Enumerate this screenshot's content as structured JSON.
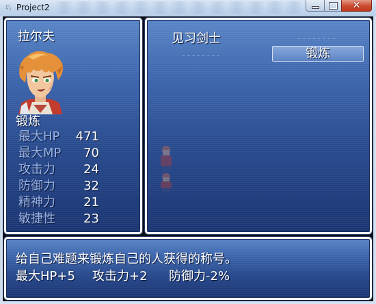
{
  "window": {
    "title": "Project2"
  },
  "status": {
    "actor_name": "拉尔夫",
    "current_title": "锻炼",
    "stats": [
      {
        "label": "最大HP",
        "value": "471"
      },
      {
        "label": "最大MP",
        "value": "70"
      },
      {
        "label": "攻击力",
        "value": "24"
      },
      {
        "label": "防御力",
        "value": "32"
      },
      {
        "label": "精神力",
        "value": "21"
      },
      {
        "label": "敏捷性",
        "value": "23"
      }
    ]
  },
  "titles": {
    "left_name": "见习剑士",
    "left_placeholder": "--------",
    "right_placeholder": "--------",
    "selected": "锻炼"
  },
  "help": {
    "description": "给自己难题来锻炼自己的人获得的称号。",
    "effects": [
      "最大HP+5",
      "攻击力+2",
      "防御力-2%"
    ]
  },
  "colors": {
    "window_top": "#5a86c6",
    "window_bottom": "#1b3572",
    "system_text": "#97b2e6",
    "normal_text": "#ffffff"
  }
}
